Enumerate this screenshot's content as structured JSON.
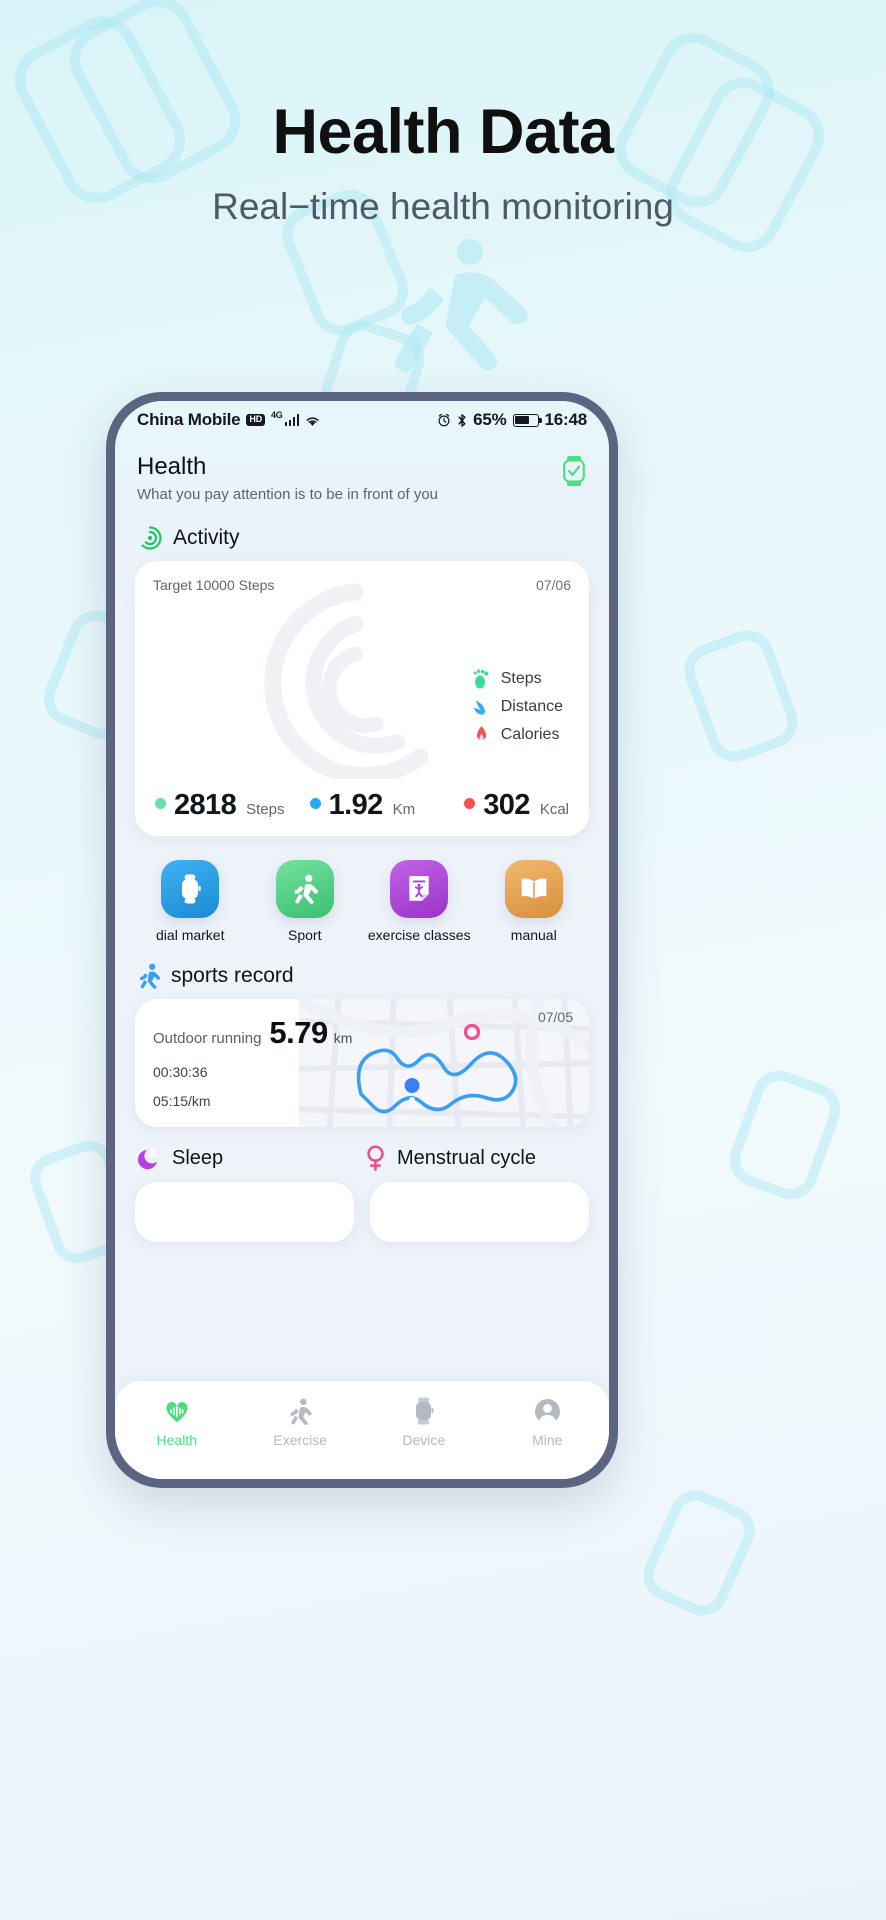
{
  "hero": {
    "title": "Health Data",
    "subtitle": "Real−time health monitoring"
  },
  "phone": {
    "status_bar": {
      "carrier": "China Mobile",
      "hd_badge": "HD",
      "network": "4G",
      "battery_percent": "65%",
      "time": "16:48",
      "icons": [
        "hd-icon",
        "signal-bars-icon",
        "wifi-icon",
        "alarm-clock-icon",
        "bluetooth-icon",
        "battery-icon"
      ]
    },
    "header": {
      "title": "Health",
      "subtitle": "What you pay attention is to be in front of you",
      "watch_icon": "watch-check-icon"
    },
    "activity": {
      "section_title": "Activity",
      "section_icon": "activity-rings-icon",
      "target_label": "Target 10000 Steps",
      "date": "07/06",
      "legend": [
        {
          "icon": "footprint-icon",
          "label": "Steps",
          "color": "#57dd9a"
        },
        {
          "icon": "wave-icon",
          "label": "Distance",
          "color": "#34a8f0"
        },
        {
          "icon": "flame-icon",
          "label": "Calories",
          "color": "#f4524e"
        }
      ],
      "stats": [
        {
          "value": "2818",
          "unit": "Steps",
          "color": "#6ce0a4"
        },
        {
          "value": "1.92",
          "unit": "Km",
          "color": "#2ba6f2"
        },
        {
          "value": "302",
          "unit": "Kcal",
          "color": "#f4524e"
        }
      ]
    },
    "shortcuts": [
      {
        "label": "dial market",
        "icon": "watch-face-icon",
        "color_from": "#35a9ef",
        "color_to": "#1f8fd8"
      },
      {
        "label": "Sport",
        "icon": "runner-icon",
        "color_from": "#67dd95",
        "color_to": "#3fc174"
      },
      {
        "label": "exercise classes",
        "icon": "exercise-card-icon",
        "color_from": "#b95ae0",
        "color_to": "#9b35c9"
      },
      {
        "label": "manual",
        "icon": "book-icon",
        "color_from": "#eeb268",
        "color_to": "#d9903f"
      }
    ],
    "sports_record": {
      "section_title": "sports record",
      "section_icon": "running-icon",
      "type": "Outdoor running",
      "distance": "5.79",
      "distance_unit": "km",
      "date": "07/05",
      "duration": "00:30:36",
      "pace": "05:15/km"
    },
    "dual_sections": [
      {
        "title": "Sleep",
        "icon": "moon-z-icon",
        "color": "#b33fe0"
      },
      {
        "title": "Menstrual cycle",
        "icon": "female-symbol-icon",
        "color": "#f0478f"
      }
    ],
    "tabbar": {
      "active": "Health",
      "items": [
        {
          "label": "Health",
          "icon": "heart-pulse-icon",
          "active": true
        },
        {
          "label": "Exercise",
          "icon": "runner-icon",
          "active": false
        },
        {
          "label": "Device",
          "icon": "watch-icon",
          "active": false
        },
        {
          "label": "Mine",
          "icon": "profile-icon",
          "active": false
        }
      ]
    }
  },
  "colors": {
    "accent_green": "#4ade80",
    "tab_inactive": "#b4b9c2"
  }
}
